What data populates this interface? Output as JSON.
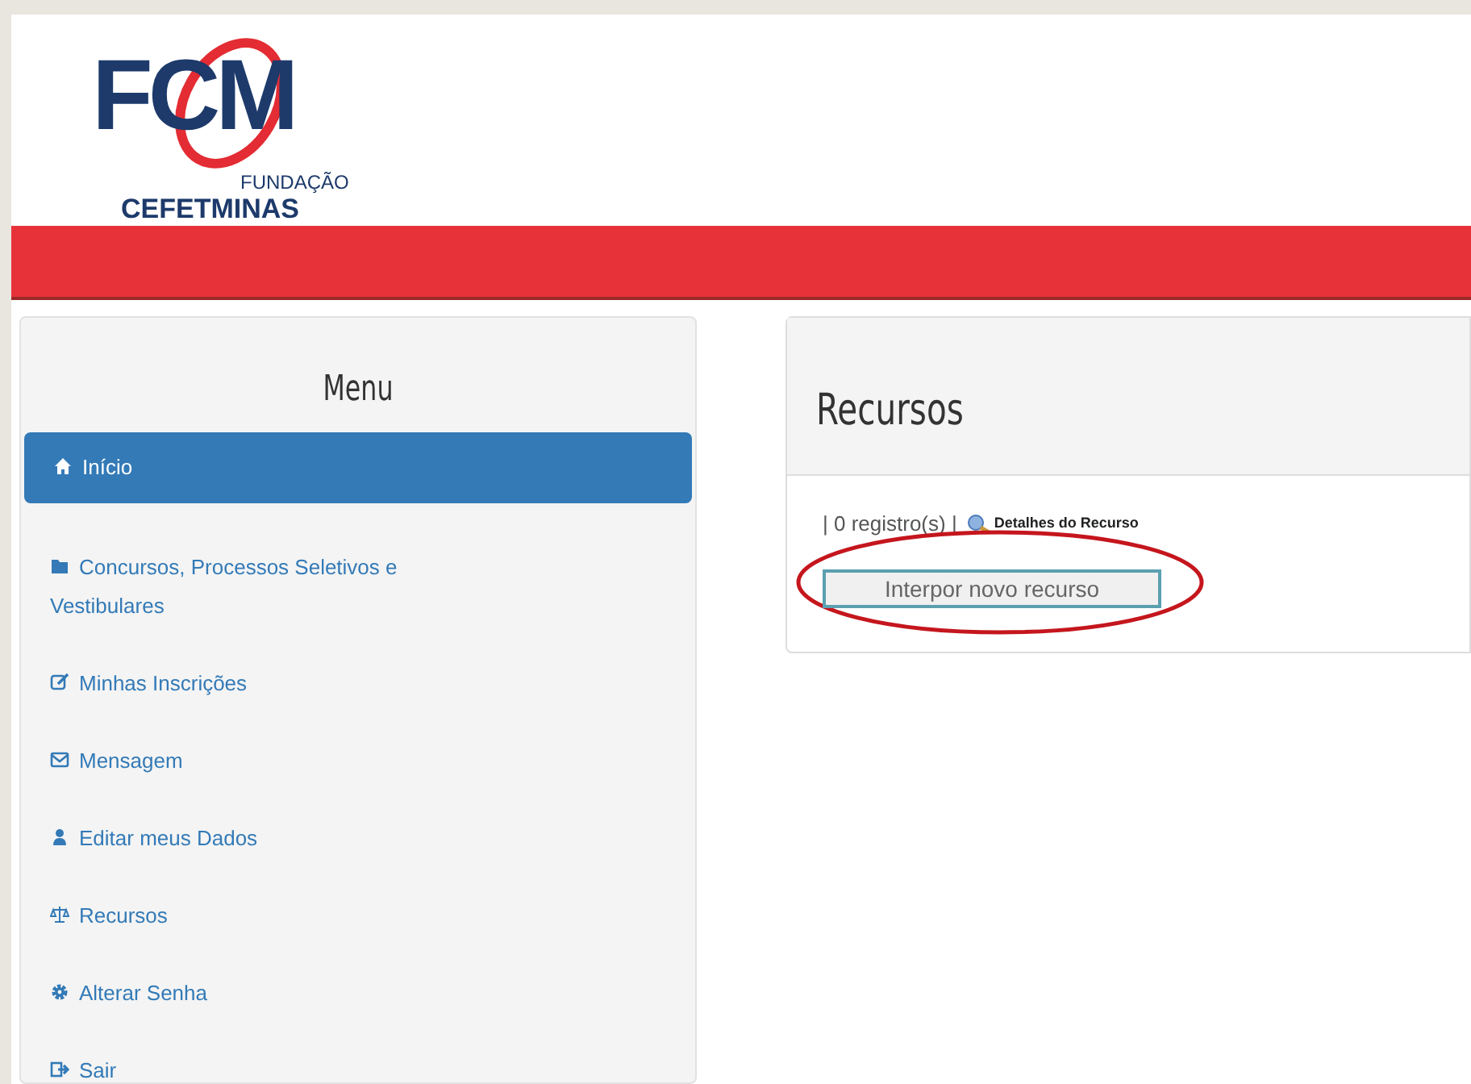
{
  "logo": {
    "mark": "FCM",
    "line_1": "FUNDAÇÃO",
    "line_2": "CEFETMINAS"
  },
  "sidebar": {
    "title": "Menu",
    "items": [
      {
        "label": "Início",
        "selected": true
      },
      {
        "label": "Concursos, Processos Seletivos e Vestibulares",
        "selected": false
      },
      {
        "label": "Minhas Inscrições",
        "selected": false
      },
      {
        "label": "Mensagem",
        "selected": false
      },
      {
        "label": "Editar meus Dados",
        "selected": false
      },
      {
        "label": "Recursos",
        "selected": false
      },
      {
        "label": "Alterar Senha",
        "selected": false
      },
      {
        "label": "Sair",
        "selected": false
      }
    ]
  },
  "panel": {
    "title": "Recursos",
    "count": "| 0 registro(s) |",
    "details_link": "Detalhes do Recurso",
    "button": "Interpor novo recurso"
  }
}
